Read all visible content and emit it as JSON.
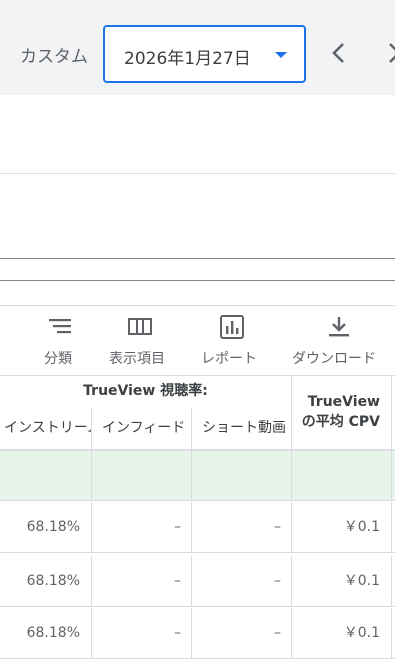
{
  "header": {
    "range_label": "カスタム",
    "date_value": "2026年1月27日"
  },
  "toolbar": {
    "segment_label": "分類",
    "columns_label": "表示項目",
    "report_label": "レポート",
    "download_label": "ダウンロード"
  },
  "table": {
    "group_header": "TrueView 視聴率:",
    "cpv_header_line1": "TrueView",
    "cpv_header_line2": "の平均 CPV",
    "sub_headers": [
      "インストリーム",
      "インフィード",
      "ショート動画"
    ],
    "rows": [
      {
        "instream": "68.18%",
        "infeed": "–",
        "shorts": "–",
        "cpv": "￥0.1"
      },
      {
        "instream": "68.18%",
        "infeed": "–",
        "shorts": "–",
        "cpv": "￥0.1"
      },
      {
        "instream": "68.18%",
        "infeed": "–",
        "shorts": "–",
        "cpv": "￥0.1"
      }
    ]
  },
  "colors": {
    "accent": "#1a73e8",
    "summary_bg": "#e6f4ea",
    "header_bg": "#f1f3f4"
  }
}
